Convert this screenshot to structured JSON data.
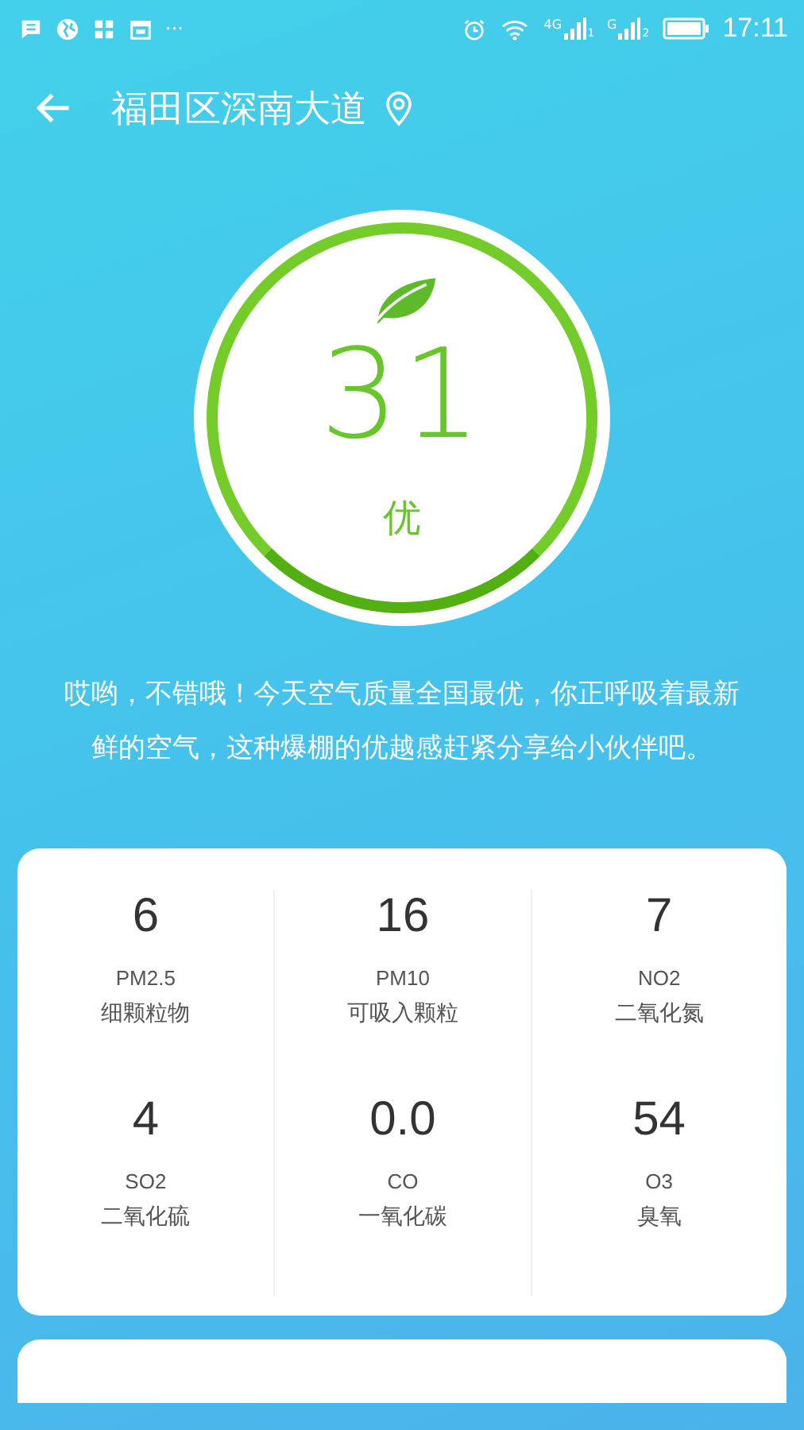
{
  "status_bar": {
    "more": "···",
    "networks": [
      {
        "type": "4G",
        "sim": "1"
      },
      {
        "type": "G",
        "sim": "2"
      }
    ],
    "time": "17:11"
  },
  "header": {
    "title": "福田区深南大道"
  },
  "aqi": {
    "value": "31",
    "grade": "优"
  },
  "message": "哎哟，不错哦！今天空气质量全国最优，你正呼吸着最新鲜的空气，这种爆棚的优越感赶紧分享给小伙伴吧。",
  "pollutants": [
    {
      "value": "6",
      "code": "PM2.5",
      "name": "细颗粒物"
    },
    {
      "value": "16",
      "code": "PM10",
      "name": "可吸入颗粒"
    },
    {
      "value": "7",
      "code": "NO2",
      "name": "二氧化氮"
    },
    {
      "value": "4",
      "code": "SO2",
      "name": "二氧化硫"
    },
    {
      "value": "0.0",
      "code": "CO",
      "name": "一氧化碳"
    },
    {
      "value": "54",
      "code": "O3",
      "name": "臭氧"
    }
  ]
}
